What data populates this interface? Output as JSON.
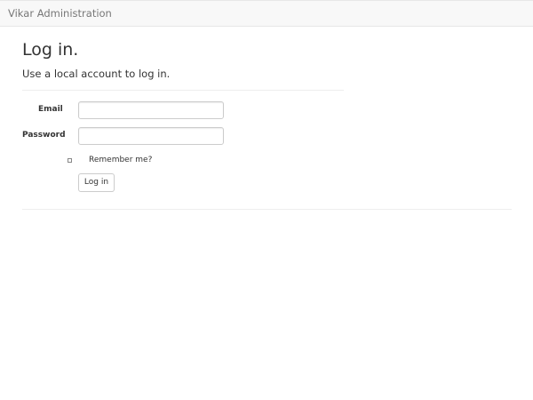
{
  "navbar": {
    "brand": "Vikar Administration"
  },
  "login": {
    "title": "Log in.",
    "subtitle": "Use a local account to log in.",
    "email_label": "Email",
    "email_value": "",
    "password_label": "Password",
    "password_value": "",
    "remember_label": "Remember me?",
    "remember_checked": false,
    "submit_label": "Log in"
  }
}
